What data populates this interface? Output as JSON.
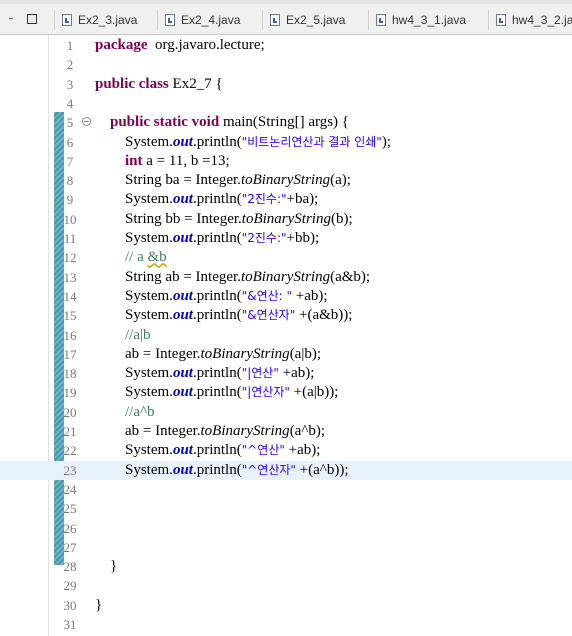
{
  "window_controls": {
    "minimize": "–",
    "maximize": ""
  },
  "tabs": [
    {
      "label": "Ex2_3.java"
    },
    {
      "label": "Ex2_4.java"
    },
    {
      "label": "Ex2_5.java"
    },
    {
      "label": "hw4_3_1.java"
    },
    {
      "label": "hw4_3_2.ja"
    }
  ],
  "editor": {
    "current_line": 23,
    "lines": [
      {
        "n": "1",
        "segs": [
          [
            "kw",
            "package"
          ],
          [
            "",
            "  org.javaro.lecture;"
          ]
        ]
      },
      {
        "n": "2",
        "segs": []
      },
      {
        "n": "3",
        "segs": [
          [
            "kw",
            "public class"
          ],
          [
            "",
            " Ex2_7 {"
          ]
        ]
      },
      {
        "n": "4",
        "segs": []
      },
      {
        "n": "5",
        "segs": [
          [
            "",
            "    "
          ],
          [
            "kw",
            "public static void"
          ],
          [
            "",
            " main(String[] args) {"
          ]
        ]
      },
      {
        "n": "6",
        "segs": [
          [
            "",
            "        System."
          ],
          [
            "fld",
            "out"
          ],
          [
            "",
            ".println("
          ],
          [
            "str",
            "\"비트논리연산과 결과 인쇄\""
          ],
          [
            "",
            ");"
          ]
        ]
      },
      {
        "n": "7",
        "segs": [
          [
            "",
            "        "
          ],
          [
            "kw",
            "int"
          ],
          [
            "",
            " a = 11, b =13;"
          ]
        ]
      },
      {
        "n": "8",
        "segs": [
          [
            "",
            "        String ba = Integer."
          ],
          [
            "sm",
            "toBinaryString"
          ],
          [
            "",
            "(a);"
          ]
        ]
      },
      {
        "n": "9",
        "segs": [
          [
            "",
            "        System."
          ],
          [
            "fld",
            "out"
          ],
          [
            "",
            ".println("
          ],
          [
            "str",
            "\"2진수:\""
          ],
          [
            "",
            "+ba);"
          ]
        ]
      },
      {
        "n": "10",
        "segs": [
          [
            "",
            "        String bb = Integer."
          ],
          [
            "sm",
            "toBinaryString"
          ],
          [
            "",
            "(b);"
          ]
        ]
      },
      {
        "n": "11",
        "segs": [
          [
            "",
            "        System."
          ],
          [
            "fld",
            "out"
          ],
          [
            "",
            ".println("
          ],
          [
            "str",
            "\"2진수:\""
          ],
          [
            "",
            "+bb);"
          ]
        ]
      },
      {
        "n": "12",
        "segs": [
          [
            "",
            "        "
          ],
          [
            "cm",
            "// a "
          ],
          [
            "cmul",
            "&b"
          ]
        ]
      },
      {
        "n": "13",
        "segs": [
          [
            "",
            "        String ab = Integer."
          ],
          [
            "sm",
            "toBinaryString"
          ],
          [
            "",
            "(a&b);"
          ]
        ]
      },
      {
        "n": "14",
        "segs": [
          [
            "",
            "        System."
          ],
          [
            "fld",
            "out"
          ],
          [
            "",
            ".println("
          ],
          [
            "str",
            "\"&연산: \""
          ],
          [
            "",
            " +ab);"
          ]
        ]
      },
      {
        "n": "15",
        "segs": [
          [
            "",
            "        System."
          ],
          [
            "fld",
            "out"
          ],
          [
            "",
            ".println("
          ],
          [
            "str",
            "\"&연산자\""
          ],
          [
            "",
            " +(a&b));"
          ]
        ]
      },
      {
        "n": "16",
        "segs": [
          [
            "",
            "        "
          ],
          [
            "cm",
            "//a|b"
          ]
        ]
      },
      {
        "n": "17",
        "segs": [
          [
            "",
            "        ab = Integer."
          ],
          [
            "sm",
            "toBinaryString"
          ],
          [
            "",
            "(a|b);"
          ]
        ]
      },
      {
        "n": "18",
        "segs": [
          [
            "",
            "        System."
          ],
          [
            "fld",
            "out"
          ],
          [
            "",
            ".println("
          ],
          [
            "str",
            "\"|연산\""
          ],
          [
            "",
            " +ab);"
          ]
        ]
      },
      {
        "n": "19",
        "segs": [
          [
            "",
            "        System."
          ],
          [
            "fld",
            "out"
          ],
          [
            "",
            ".println("
          ],
          [
            "str",
            "\"|연산자\""
          ],
          [
            "",
            " +(a|b));"
          ]
        ]
      },
      {
        "n": "20",
        "segs": [
          [
            "",
            "        "
          ],
          [
            "cm",
            "//a^b"
          ]
        ]
      },
      {
        "n": "21",
        "segs": [
          [
            "",
            "        ab = Integer."
          ],
          [
            "sm",
            "toBinaryString"
          ],
          [
            "",
            "(a^b);"
          ]
        ]
      },
      {
        "n": "22",
        "segs": [
          [
            "",
            "        System."
          ],
          [
            "fld",
            "out"
          ],
          [
            "",
            ".println("
          ],
          [
            "str",
            "\"^연산\""
          ],
          [
            "",
            " +ab);"
          ]
        ]
      },
      {
        "n": "23",
        "segs": [
          [
            "",
            "        System."
          ],
          [
            "fld",
            "out"
          ],
          [
            "",
            ".println("
          ],
          [
            "str",
            "\"^연산자\""
          ],
          [
            "",
            " +(a^b));"
          ]
        ]
      },
      {
        "n": "24",
        "segs": []
      },
      {
        "n": "25",
        "segs": []
      },
      {
        "n": "26",
        "segs": []
      },
      {
        "n": "27",
        "segs": []
      },
      {
        "n": "28",
        "segs": [
          [
            "",
            "    }"
          ]
        ]
      },
      {
        "n": "29",
        "segs": []
      },
      {
        "n": "30",
        "segs": [
          [
            "",
            "}"
          ]
        ]
      },
      {
        "n": "31",
        "segs": []
      }
    ]
  }
}
